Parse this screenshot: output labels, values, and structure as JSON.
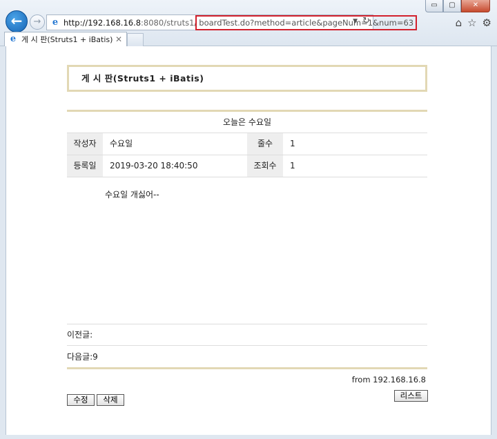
{
  "browser": {
    "window_buttons": {
      "minimize": "▭",
      "maximize": "▢",
      "close": "✕"
    },
    "back_glyph": "←",
    "forward_glyph": "→",
    "address": {
      "host": "http://192.168.16.8",
      "rest": ":8080/struts1/",
      "highlighted": "boardTest.do?method=article&pageNum=1&num=63",
      "dropdown_glyph": "▼",
      "refresh_glyph": "↻"
    },
    "tab": {
      "label": "게 시 판(Struts1 + iBatis)",
      "close_glyph": "✕"
    },
    "tools": {
      "home": "⌂",
      "favorites": "☆",
      "settings": "⚙"
    },
    "ie_glyph": "e"
  },
  "page": {
    "board_title": "게 시 판(Struts1 + iBatis)",
    "subject": "오늘은 수요일",
    "labels": {
      "writer": "작성자",
      "lines": "줄수",
      "date": "등록일",
      "hits": "조회수"
    },
    "values": {
      "writer": "수요일",
      "lines": "1",
      "date": "2019-03-20 18:40:50",
      "hits": "1"
    },
    "content": "수요일 개싫어--",
    "prev": "이전글:",
    "next": "다음글:9",
    "from": "from 192.168.16.8",
    "buttons": {
      "edit": "수정",
      "delete": "삭제",
      "list": "리스트"
    }
  }
}
